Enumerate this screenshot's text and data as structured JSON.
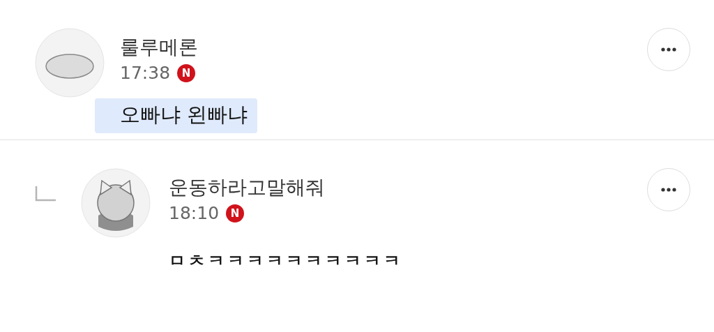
{
  "comments": [
    {
      "author": "룰루메론",
      "time": "17:38",
      "badge": "N",
      "text": "오빠냐 왼빠냐",
      "highlighted": true,
      "reply": false
    },
    {
      "author": "운동하라고말해줘",
      "time": "18:10",
      "badge": "N",
      "text": "ㅁㅊㅋㅋㅋㅋㅋㅋㅋㅋㅋㅋ",
      "highlighted": false,
      "reply": true
    }
  ]
}
